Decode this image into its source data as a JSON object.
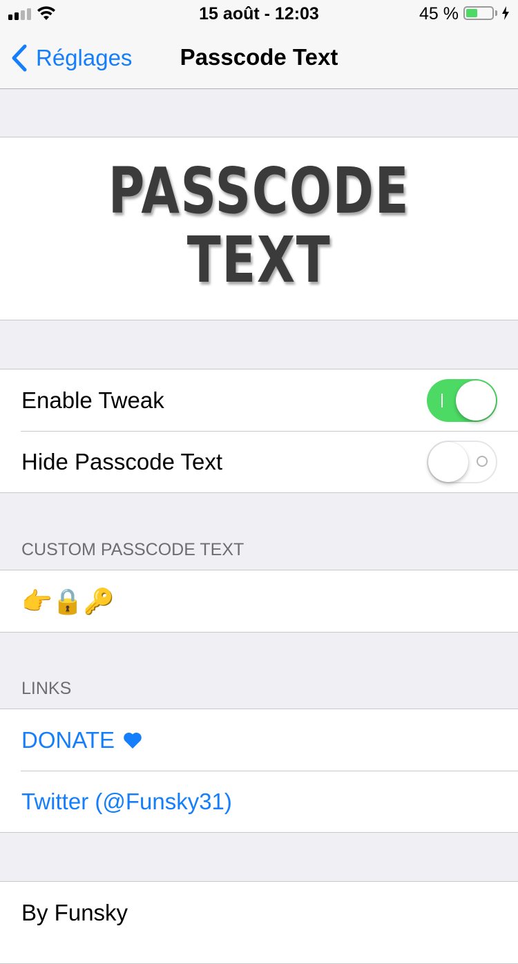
{
  "status_bar": {
    "time": "15 août - 12:03",
    "battery_percent": "45 %",
    "battery_level": 0.45,
    "signal_bars_active": 2,
    "signal_bars_total": 4
  },
  "nav": {
    "back_label": "Réglages",
    "title": "Passcode Text"
  },
  "logo": {
    "line1": "PASSCODE",
    "line2": "TEXT"
  },
  "settings": {
    "enable_tweak": {
      "label": "Enable Tweak",
      "on": true
    },
    "hide_passcode_text": {
      "label": "Hide Passcode Text",
      "on": false
    }
  },
  "custom_section": {
    "header": "CUSTOM PASSCODE TEXT",
    "value": "👉🔒🔑"
  },
  "links_section": {
    "header": "LINKS",
    "donate": "DONATE",
    "twitter": "Twitter (@Funsky31)"
  },
  "footer": {
    "by": "By Funsky"
  },
  "colors": {
    "accent": "#157efb",
    "switch_on": "#4cd964",
    "background": "#efeff4"
  }
}
